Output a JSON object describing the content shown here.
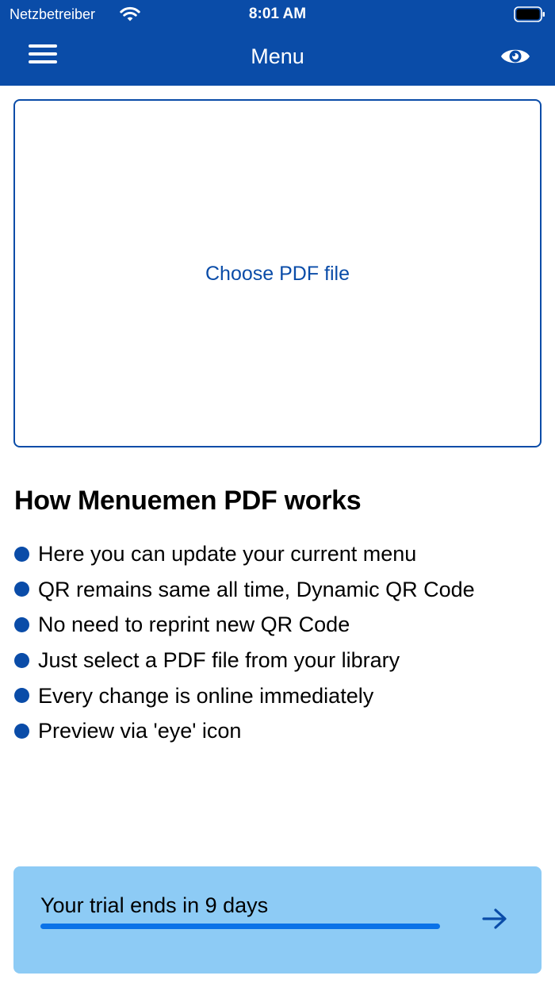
{
  "status_bar": {
    "carrier": "Netzbetreiber",
    "time": "8:01 AM",
    "wifi_icon": "wifi-icon",
    "battery_icon": "battery-icon"
  },
  "nav": {
    "title": "Menu",
    "menu_icon": "hamburger-icon",
    "preview_icon": "eye-icon"
  },
  "upload": {
    "label": "Choose PDF file"
  },
  "how_it_works": {
    "title": "How Menuemen PDF works",
    "items": [
      "Here you can update your current menu",
      "QR remains same all time, Dynamic QR Code",
      "No need to reprint new QR Code",
      "Just select a PDF file from your library",
      "Every change is online immediately",
      "Preview via 'eye' icon"
    ]
  },
  "trial": {
    "text": "Your trial ends in 9 days",
    "arrow_icon": "arrow-right-icon"
  },
  "colors": {
    "brand": "#0a4ca8",
    "trial_background": "#8dcbf5",
    "progress": "#0a72e8"
  }
}
